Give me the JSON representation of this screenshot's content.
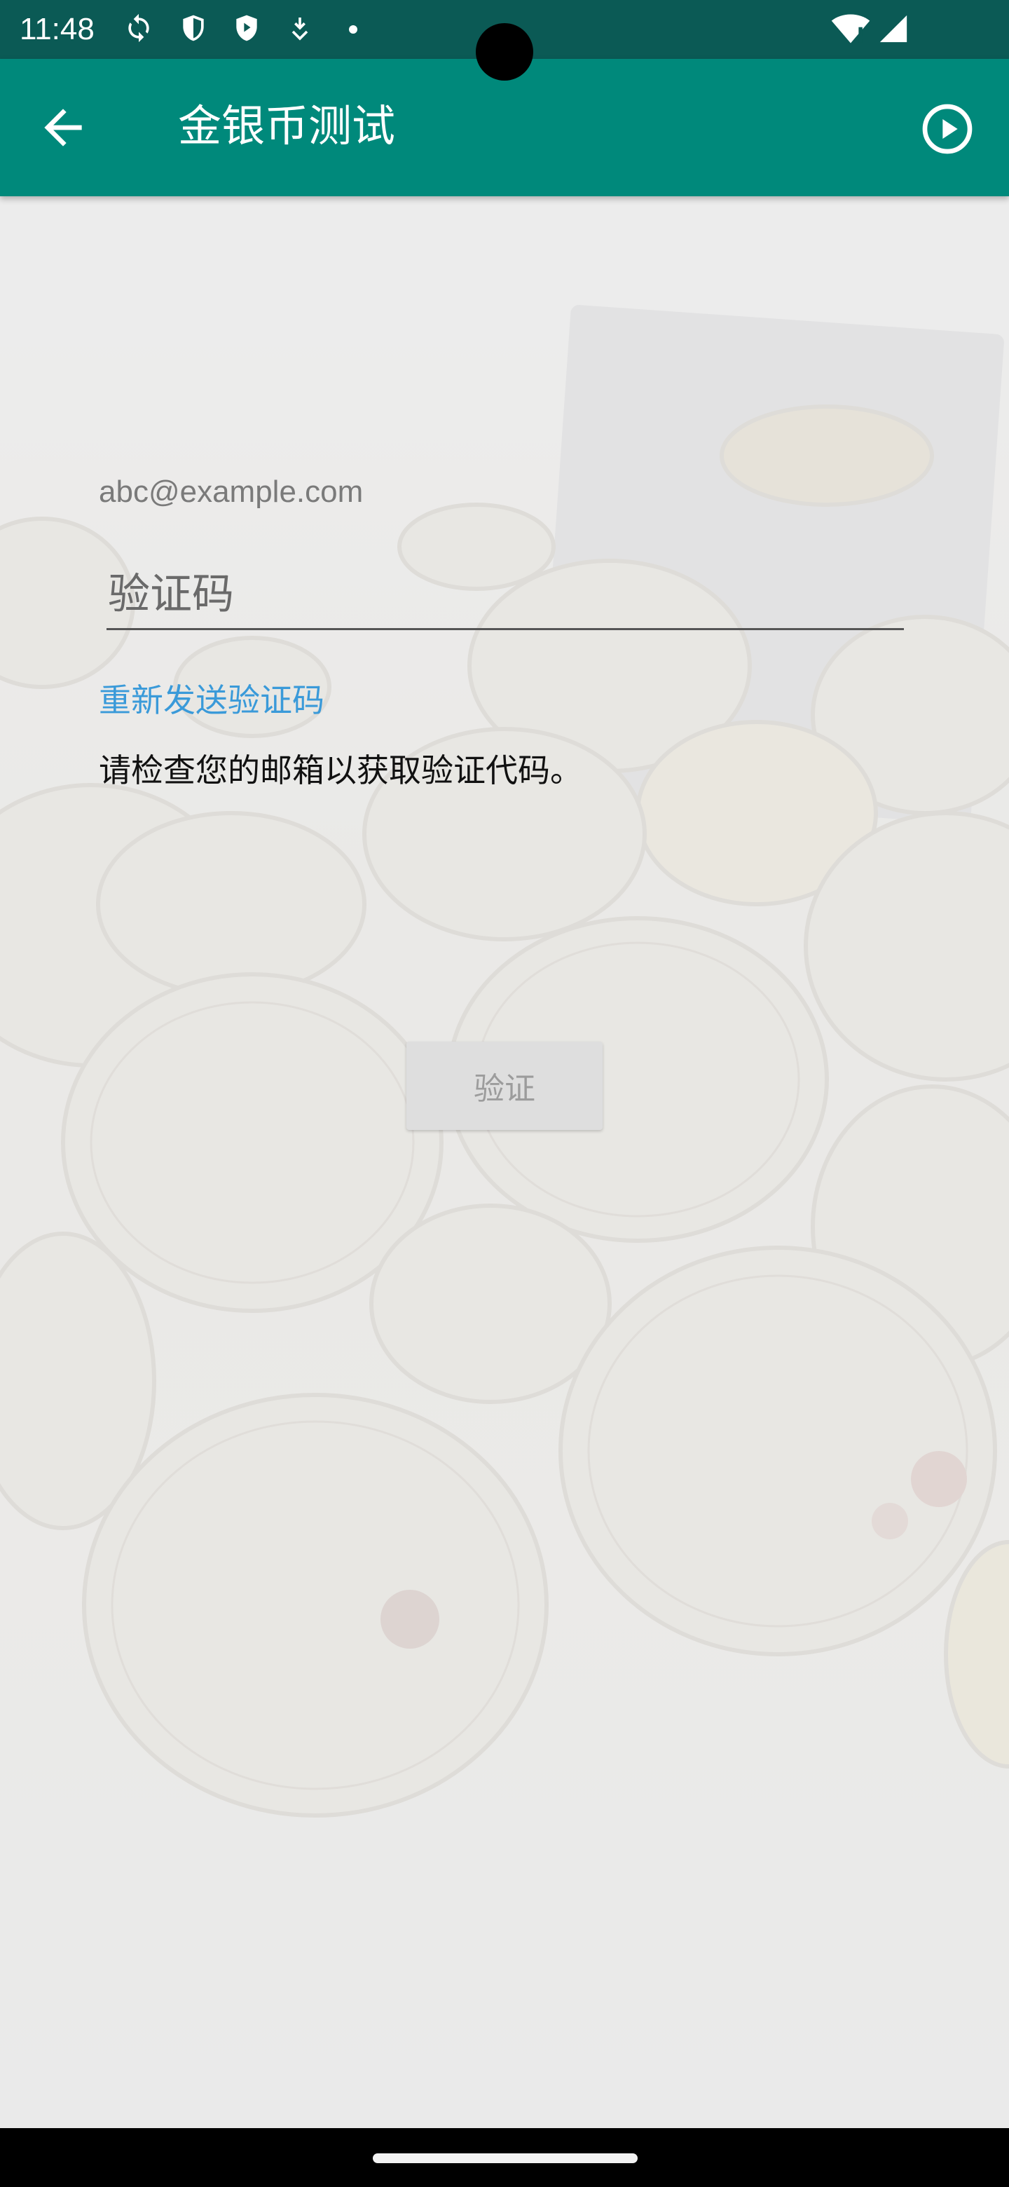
{
  "status_bar": {
    "time": "11:48",
    "icons": [
      "sync-icon",
      "shield-icon",
      "play-protect-icon",
      "download-icon",
      "dot-icon",
      "wifi-icon",
      "signal-icon"
    ]
  },
  "app_bar": {
    "title": "金银币测试",
    "back_icon": "arrow-back-icon",
    "action_icon": "play-circle-icon",
    "color": "#00897b"
  },
  "form": {
    "email": "abc@example.com",
    "code_placeholder": "验证码",
    "code_value": "",
    "resend_label": "重新发送验证码",
    "hint": "请检查您的邮箱以获取验证代码。",
    "verify_label": "验证",
    "link_color": "#3a9ad9"
  }
}
